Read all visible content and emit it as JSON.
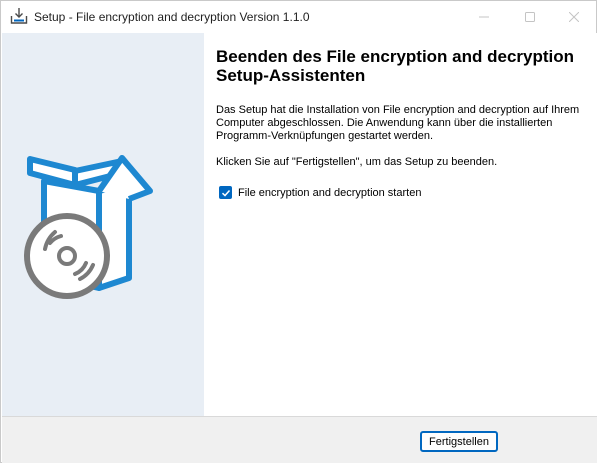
{
  "window": {
    "title": "Setup - File encryption and decryption Version 1.1.0",
    "controls": {
      "minimize": "minimize-icon",
      "maximize": "maximize-icon",
      "close": "close-icon"
    }
  },
  "sidebar": {
    "illustration": "box-disc-icon",
    "accent": "#1e88d1",
    "disc_color": "#7a7a7a"
  },
  "content": {
    "heading": "Beenden des File encryption and decryption Setup-Assistenten",
    "paragraph1": "Das Setup hat die Installation von File encryption and decryption auf Ihrem Computer abgeschlossen. Die Anwendung kann über die installierten Programm-Verknüpfungen gestartet werden.",
    "paragraph2": "Klicken Sie auf \"Fertigstellen\", um das Setup zu beenden.",
    "launch_checkbox": {
      "label": "File encryption and decryption starten",
      "checked": true
    }
  },
  "footer": {
    "finish_label": "Fertigstellen"
  },
  "colors": {
    "accent": "#0067c0",
    "sidebar_bg": "#e8eef5",
    "footer_bg": "#f0f0f0"
  }
}
